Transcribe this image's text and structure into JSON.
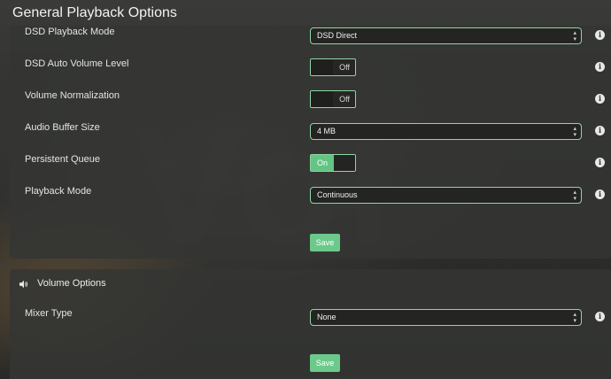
{
  "page": {
    "title": "General Playback Options"
  },
  "general": {
    "rows": [
      {
        "label": "DSD Playback Mode",
        "type": "select",
        "value": "DSD Direct"
      },
      {
        "label": "DSD Auto Volume Level",
        "type": "toggle",
        "value": "Off"
      },
      {
        "label": "Volume Normalization",
        "type": "toggle",
        "value": "Off"
      },
      {
        "label": "Audio Buffer Size",
        "type": "select",
        "value": "4 MB"
      },
      {
        "label": "Persistent Queue",
        "type": "toggle",
        "value": "On"
      },
      {
        "label": "Playback Mode",
        "type": "select",
        "value": "Continuous"
      }
    ],
    "save_label": "Save"
  },
  "volume": {
    "title": "Volume Options",
    "icon": "speaker-icon",
    "rows": [
      {
        "label": "Mixer Type",
        "type": "select",
        "value": "None"
      }
    ],
    "save_label": "Save"
  },
  "icons": {
    "info_glyph": "i",
    "caret_glyph": "⌃⌄"
  },
  "colors": {
    "accent": "#6cc98b",
    "accent_border": "#8fd6a4",
    "panel": "#343533"
  }
}
